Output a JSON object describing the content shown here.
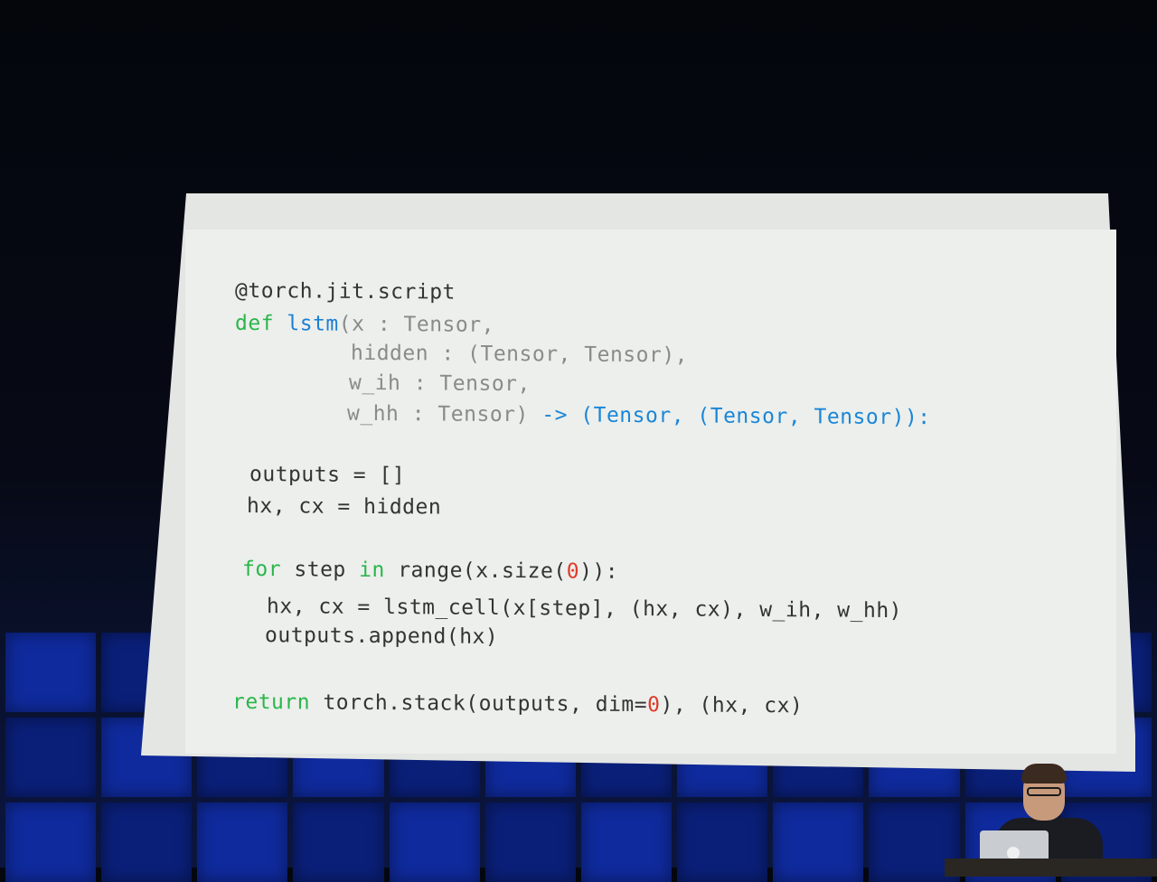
{
  "slide": {
    "lines": [
      {
        "segments": [
          {
            "text": "@torch.jit.script",
            "cls": "dec"
          }
        ]
      },
      {
        "segments": [
          {
            "text": "def ",
            "cls": "kw"
          },
          {
            "text": "lstm",
            "cls": "fn"
          },
          {
            "text": "(x : Tensor,",
            "cls": "arg"
          }
        ]
      },
      {
        "segments": [
          {
            "text": "hidden : (Tensor, Tensor),",
            "cls": "arg"
          }
        ]
      },
      {
        "segments": [
          {
            "text": "w_ih : Tensor,",
            "cls": "arg"
          }
        ]
      },
      {
        "segments": [
          {
            "text": "w_hh : Tensor) ",
            "cls": "arg"
          },
          {
            "text": "-> (Tensor, (Tensor, Tensor)):",
            "cls": "ann"
          }
        ]
      },
      {
        "segments": [
          {
            "text": "outputs = []",
            "cls": "dec"
          }
        ]
      },
      {
        "segments": [
          {
            "text": "hx, cx = hidden",
            "cls": "dec"
          }
        ]
      },
      {
        "segments": [
          {
            "text": "for ",
            "cls": "kw"
          },
          {
            "text": "step ",
            "cls": "dec"
          },
          {
            "text": "in ",
            "cls": "kw"
          },
          {
            "text": "range(x.size(",
            "cls": "dec"
          },
          {
            "text": "0",
            "cls": "num"
          },
          {
            "text": ")):",
            "cls": "dec"
          }
        ]
      },
      {
        "segments": [
          {
            "text": "hx, cx = lstm_cell(x[step], (hx, cx), w_ih, w_hh)",
            "cls": "dec"
          }
        ]
      },
      {
        "segments": [
          {
            "text": "outputs.append(hx)",
            "cls": "dec"
          }
        ]
      },
      {
        "segments": [
          {
            "text": "return ",
            "cls": "kw"
          },
          {
            "text": "torch.stack(outputs, dim=",
            "cls": "dec"
          },
          {
            "text": "0",
            "cls": "num"
          },
          {
            "text": "), (hx, cx)",
            "cls": "dec"
          }
        ]
      }
    ]
  },
  "colors": {
    "keyword": "#2ab64a",
    "function_name": "#1a7fd4",
    "argument": "#8a8a8a",
    "annotation": "#1a86d8",
    "number": "#e03a2a",
    "screen": "#ecefec",
    "tile_wall": "#0f2a9c"
  }
}
